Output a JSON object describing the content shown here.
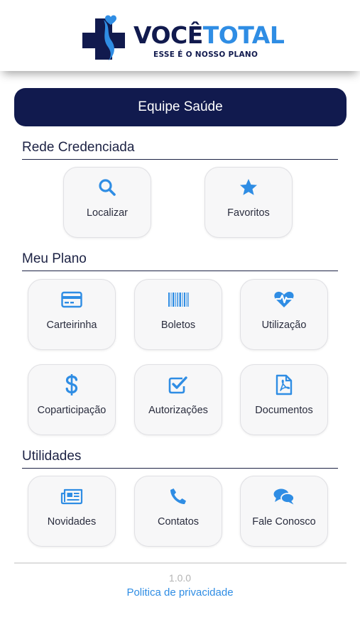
{
  "brand": {
    "name_part1": "VOCÊ",
    "name_part2": "TOTAL",
    "tagline": "ESSE É O NOSSO PLANO",
    "colors": {
      "navy": "#111a4e",
      "blue": "#2f8de4"
    }
  },
  "team_button": {
    "label": "Equipe Saúde"
  },
  "sections": {
    "rede": {
      "title": "Rede Credenciada",
      "items": [
        {
          "label": "Localizar",
          "icon": "search-icon"
        },
        {
          "label": "Favoritos",
          "icon": "star-icon"
        }
      ]
    },
    "plano": {
      "title": "Meu Plano",
      "items": [
        {
          "label": "Carteirinha",
          "icon": "card-icon"
        },
        {
          "label": "Boletos",
          "icon": "barcode-icon"
        },
        {
          "label": "Utilização",
          "icon": "heartbeat-icon"
        },
        {
          "label": "Coparticipação",
          "icon": "dollar-icon"
        },
        {
          "label": "Autorizações",
          "icon": "checkbox-icon"
        },
        {
          "label": "Documentos",
          "icon": "pdf-file-icon"
        }
      ]
    },
    "utilidades": {
      "title": "Utilidades",
      "items": [
        {
          "label": "Novidades",
          "icon": "newspaper-icon"
        },
        {
          "label": "Contatos",
          "icon": "phone-icon"
        },
        {
          "label": "Fale Conosco",
          "icon": "chat-icon"
        }
      ]
    }
  },
  "footer": {
    "version": "1.0.0",
    "privacy_link": "Politica de privacidade"
  }
}
